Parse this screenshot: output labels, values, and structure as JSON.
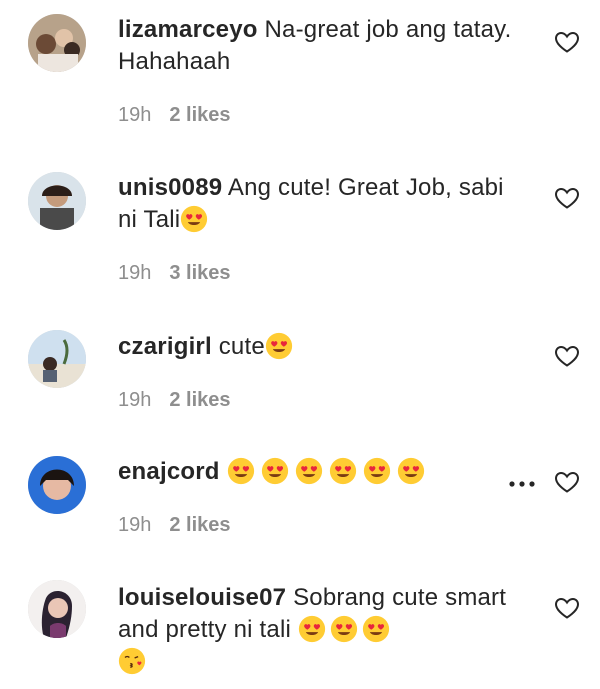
{
  "comments": [
    {
      "user": "lizamarceyo",
      "text": "Na-great job ang tatay. Hahahaah",
      "time": "19h",
      "likes": "2 likes"
    },
    {
      "user": "unis0089",
      "text": "Ang cute! Great Job, sabi ni Tali",
      "time": "19h",
      "likes": "3 likes"
    },
    {
      "user": "czarigirl",
      "text": "cute",
      "time": "19h",
      "likes": "2 likes"
    },
    {
      "user": "enajcord",
      "text": "",
      "time": "19h",
      "likes": "2 likes"
    },
    {
      "user": "louiselouise07",
      "text": "Sobrang cute smart and pretty ni tali",
      "time": "",
      "likes": ""
    }
  ],
  "icons": {
    "like": "heart-outline-icon",
    "more": "ellipsis-icon",
    "emoji_love": "heart-eyes-emoji",
    "emoji_kiss": "kissing-heart-emoji"
  },
  "colors": {
    "text": "#262626",
    "meta": "#8e8e8e",
    "emoji": "#FFCC33",
    "heart": "#E8263C"
  }
}
